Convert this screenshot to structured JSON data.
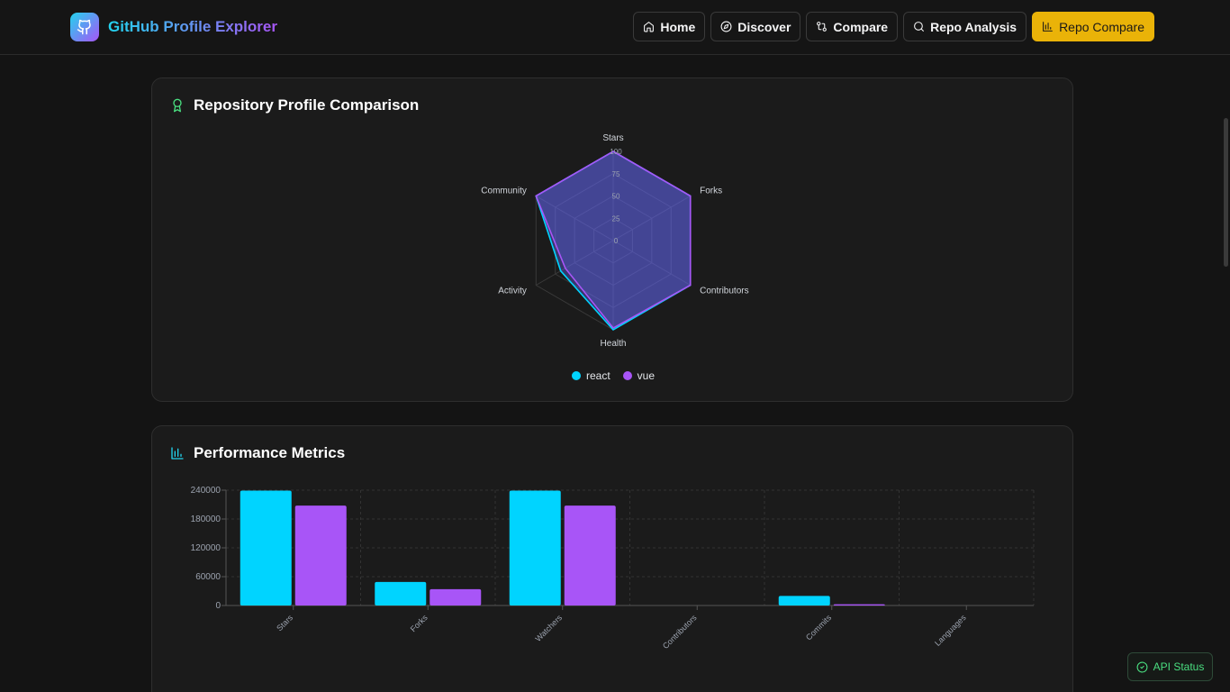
{
  "header": {
    "title": "GitHub Profile Explorer",
    "nav": [
      {
        "label": "Home",
        "icon": "home-icon",
        "active": false
      },
      {
        "label": "Discover",
        "icon": "compass-icon",
        "active": false
      },
      {
        "label": "Compare",
        "icon": "git-compare-icon",
        "active": false
      },
      {
        "label": "Repo Analysis",
        "icon": "search-icon",
        "active": false
      },
      {
        "label": "Repo Compare",
        "icon": "bar-chart-icon",
        "active": true
      }
    ]
  },
  "colors": {
    "react": "#00d4ff",
    "vue": "#a855f7",
    "accent": "#eab308",
    "success": "#4ade80"
  },
  "radar_card": {
    "title": "Repository Profile Comparison",
    "icon": "award-icon"
  },
  "metrics_card": {
    "title": "Performance Metrics",
    "icon": "bar-chart-icon"
  },
  "api_status": {
    "label": "API Status",
    "icon": "check-circle-icon"
  },
  "chart_data": [
    {
      "type": "radar",
      "axes": [
        "Stars",
        "Forks",
        "Contributors",
        "Health",
        "Activity",
        "Community"
      ],
      "rticks": [
        "0",
        "25",
        "50",
        "75",
        "100"
      ],
      "rlim": [
        0,
        100
      ],
      "series": [
        {
          "name": "react",
          "values": [
            100,
            100,
            100,
            100,
            68,
            100
          ]
        },
        {
          "name": "vue",
          "values": [
            100,
            100,
            100,
            98,
            62,
            100
          ]
        }
      ],
      "legend": "bottom"
    },
    {
      "type": "bar",
      "categories": [
        "Stars",
        "Forks",
        "Watchers",
        "Contributors",
        "Commits",
        "Languages"
      ],
      "series": [
        {
          "name": "react",
          "values": [
            239000,
            49000,
            239000,
            0,
            20000,
            0
          ]
        },
        {
          "name": "vue",
          "values": [
            208000,
            34000,
            208000,
            0,
            2500,
            0
          ]
        }
      ],
      "yticks": [
        "0",
        "60000",
        "120000",
        "180000",
        "240000"
      ],
      "ylim": [
        0,
        240000
      ],
      "grid": true
    }
  ]
}
